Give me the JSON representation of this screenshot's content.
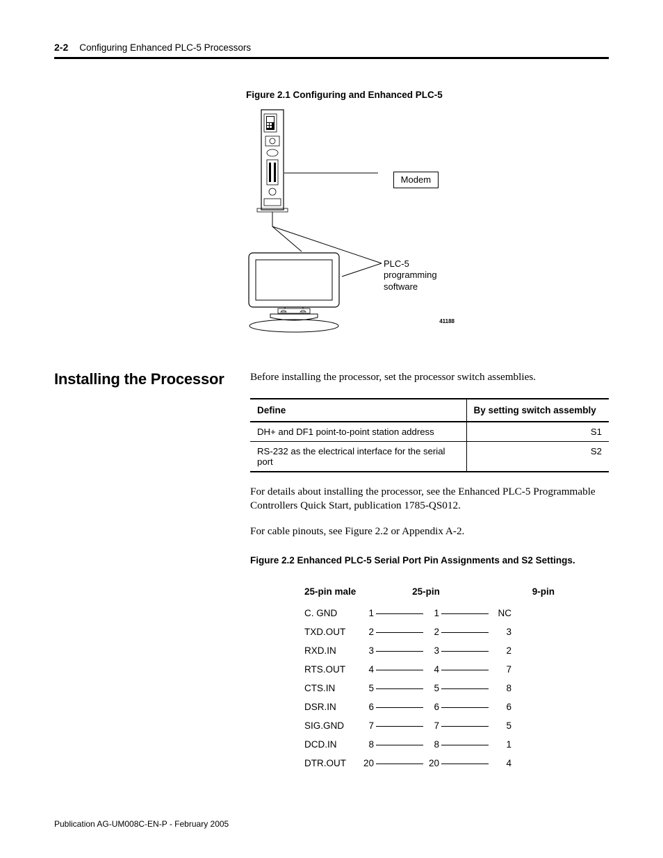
{
  "header": {
    "page_num": "2-2",
    "title": "Configuring Enhanced PLC-5 Processors"
  },
  "fig1": {
    "caption": "Figure 2.1  Configuring and Enhanced PLC-5",
    "label_modem": "Modem",
    "label_sw": "PLC-5\nprogramming\nsoftware",
    "ref": "41188"
  },
  "section": {
    "heading": "Installing the Processor",
    "intro": "Before installing the processor, set the processor switch assemblies."
  },
  "table1": {
    "head": [
      "Define",
      "By setting switch assembly"
    ],
    "rows": [
      [
        "DH+ and DF1 point-to-point station address",
        "S1"
      ],
      [
        "RS-232 as the electrical interface for the serial port",
        "S2"
      ]
    ]
  },
  "para2": "For details about installing the processor, see the Enhanced PLC-5 Programmable Controllers Quick Start, publication 1785-QS012.",
  "para3": "For cable pinouts, see Figure 2.2 or Appendix A-2.",
  "fig2": {
    "caption": "Figure 2.2 Enhanced PLC-5 Serial Port Pin Assignments and S2 Settings.",
    "headers": [
      "25-pin male",
      "25-pin",
      "9-pin"
    ],
    "rows": [
      {
        "name": "C. GND",
        "a": "1",
        "b": "1",
        "c": "NC"
      },
      {
        "name": "TXD.OUT",
        "a": "2",
        "b": "2",
        "c": "3"
      },
      {
        "name": "RXD.IN",
        "a": "3",
        "b": "3",
        "c": "2"
      },
      {
        "name": "RTS.OUT",
        "a": "4",
        "b": "4",
        "c": "7"
      },
      {
        "name": "CTS.IN",
        "a": "5",
        "b": "5",
        "c": "8"
      },
      {
        "name": "DSR.IN",
        "a": "6",
        "b": "6",
        "c": "6"
      },
      {
        "name": "SIG.GND",
        "a": "7",
        "b": "7",
        "c": "5"
      },
      {
        "name": "DCD.IN",
        "a": "8",
        "b": "8",
        "c": "1"
      },
      {
        "name": "DTR.OUT",
        "a": "20",
        "b": "20",
        "c": "4"
      }
    ]
  },
  "footer": "Publication AG-UM008C-EN-P - February 2005"
}
